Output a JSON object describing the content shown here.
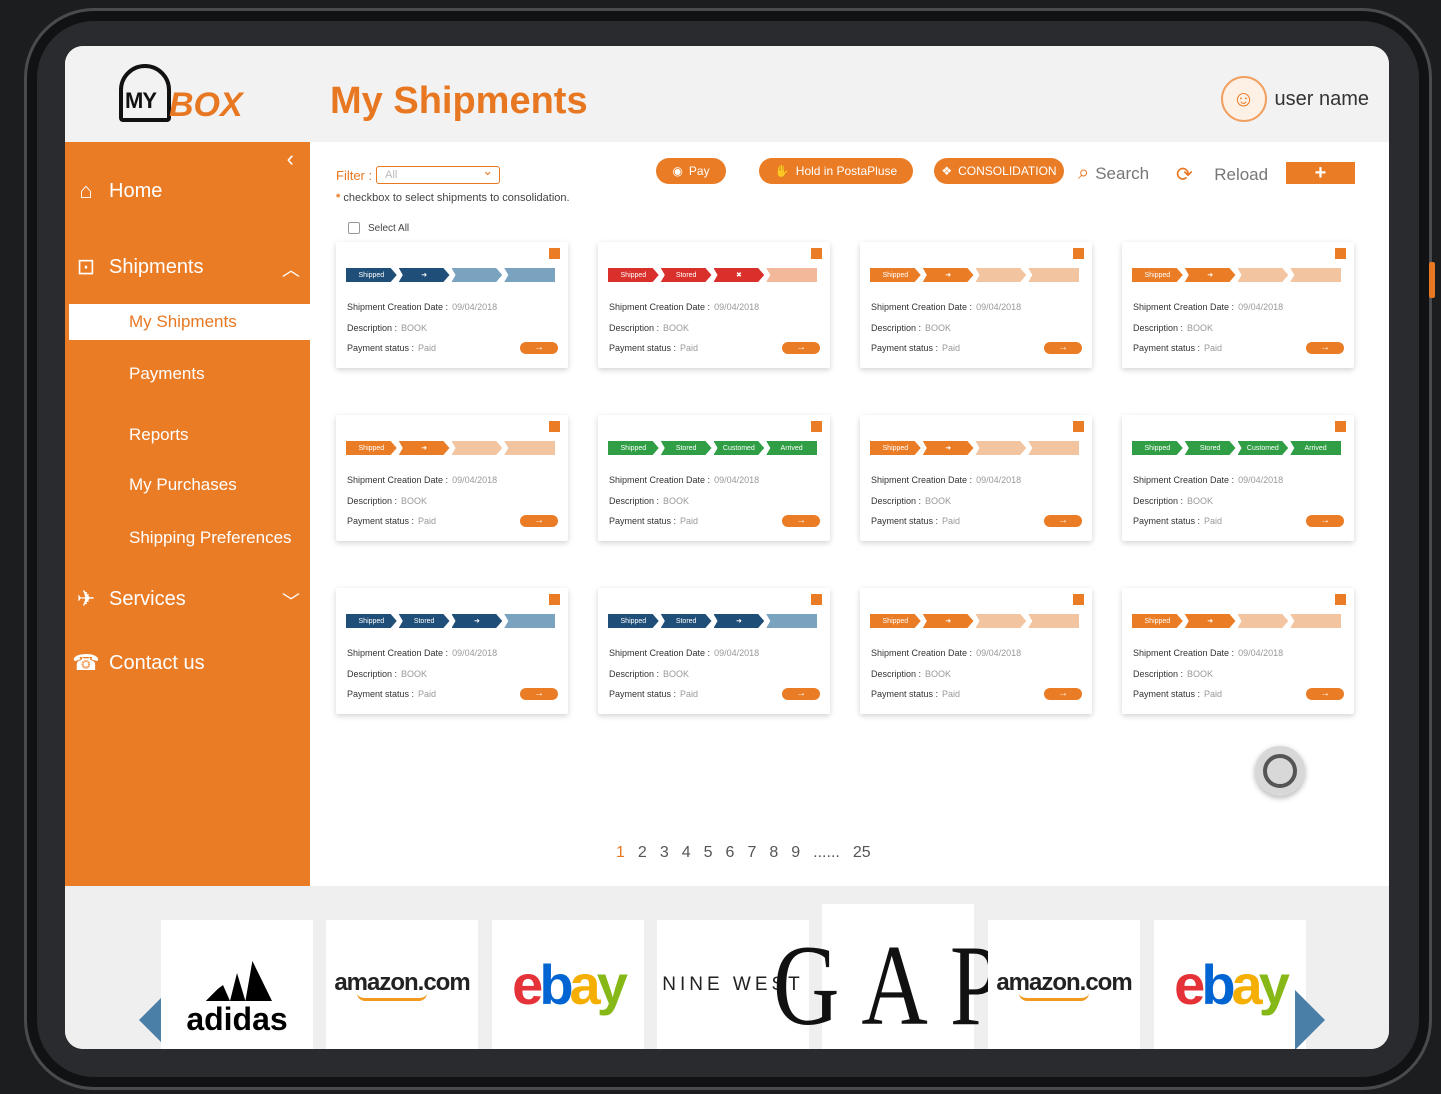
{
  "header": {
    "title": "My Shipments",
    "user_name": "user name"
  },
  "logo": {
    "my": "MY",
    "box": "BOX"
  },
  "sidebar": {
    "home": "Home",
    "shipments": "Shipments",
    "sub": [
      "My Shipments",
      "Payments",
      "Reports",
      "My Purchases",
      "Shipping Preferences"
    ],
    "services": "Services",
    "contact": "Contact us"
  },
  "toolbar": {
    "filter_label": "Filter :",
    "filter_value": "All",
    "hint": "checkbox to select shipments to consolidation.",
    "select_all": "Select All",
    "pay": "Pay",
    "hold": "Hold in PostaPluse",
    "consolidation": "CONSOLIDATION",
    "search": "Search",
    "reload": "Reload",
    "add": "+"
  },
  "card_labels": {
    "creation_date": "Shipment Creation Date :",
    "description": "Description :",
    "payment_status": "Payment status :"
  },
  "cards": [
    {
      "date": "09/04/2018",
      "desc": "BOOK",
      "pay": "Paid",
      "color": "#1f4e78",
      "rest": "#7aa3c0",
      "steps": [
        "Shipped",
        "➜",
        "",
        ""
      ]
    },
    {
      "date": "09/04/2018",
      "desc": "BOOK",
      "pay": "Paid",
      "color": "#d9302c",
      "rest": "#f2b89a",
      "steps": [
        "Shipped",
        "Stored",
        "✖",
        ""
      ]
    },
    {
      "date": "09/04/2018",
      "desc": "BOOK",
      "pay": "Paid",
      "color": "#ea7c26",
      "rest": "#f3c4a0",
      "steps": [
        "Shipped",
        "➜",
        "",
        ""
      ]
    },
    {
      "date": "09/04/2018",
      "desc": "BOOK",
      "pay": "Paid",
      "color": "#ea7c26",
      "rest": "#f3c4a0",
      "steps": [
        "Shipped",
        "➜",
        "",
        ""
      ]
    },
    {
      "date": "09/04/2018",
      "desc": "BOOK",
      "pay": "Paid",
      "color": "#ea7c26",
      "rest": "#f3c4a0",
      "steps": [
        "Shipped",
        "➜",
        "",
        ""
      ]
    },
    {
      "date": "09/04/2018",
      "desc": "BOOK",
      "pay": "Paid",
      "color": "#2f9e44",
      "rest": "#2f9e44",
      "steps": [
        "Shipped",
        "Stored",
        "Customed",
        "Arrived"
      ]
    },
    {
      "date": "09/04/2018",
      "desc": "BOOK",
      "pay": "Paid",
      "color": "#ea7c26",
      "rest": "#f3c4a0",
      "steps": [
        "Shipped",
        "➜",
        "",
        ""
      ]
    },
    {
      "date": "09/04/2018",
      "desc": "BOOK",
      "pay": "Paid",
      "color": "#2f9e44",
      "rest": "#2f9e44",
      "steps": [
        "Shipped",
        "Stored",
        "Customed",
        "Arrived"
      ]
    },
    {
      "date": "09/04/2018",
      "desc": "BOOK",
      "pay": "Paid",
      "color": "#1f4e78",
      "rest": "#7aa3c0",
      "steps": [
        "Shipped",
        "Stored",
        "➜",
        ""
      ]
    },
    {
      "date": "09/04/2018",
      "desc": "BOOK",
      "pay": "Paid",
      "color": "#1f4e78",
      "rest": "#7aa3c0",
      "steps": [
        "Shipped",
        "Stored",
        "➜",
        ""
      ]
    },
    {
      "date": "09/04/2018",
      "desc": "BOOK",
      "pay": "Paid",
      "color": "#ea7c26",
      "rest": "#f3c4a0",
      "steps": [
        "Shipped",
        "➜",
        "",
        ""
      ]
    },
    {
      "date": "09/04/2018",
      "desc": "BOOK",
      "pay": "Paid",
      "color": "#ea7c26",
      "rest": "#f3c4a0",
      "steps": [
        "Shipped",
        "➜",
        "",
        ""
      ]
    }
  ],
  "pagination": {
    "pages": [
      "1",
      "2",
      "3",
      "4",
      "5",
      "6",
      "7",
      "8",
      "9",
      "......",
      "25"
    ],
    "current": "1"
  },
  "brands": {
    "adidas": "adidas",
    "amazon": "amazon.com",
    "ebay": [
      "e",
      "b",
      "a",
      "y"
    ],
    "ninewest": "NINE WEST",
    "gap": "GAP"
  },
  "colors": {
    "accent": "#ea7c26",
    "blue": "#1f4e78",
    "green": "#2f9e44",
    "red": "#d9302c"
  }
}
